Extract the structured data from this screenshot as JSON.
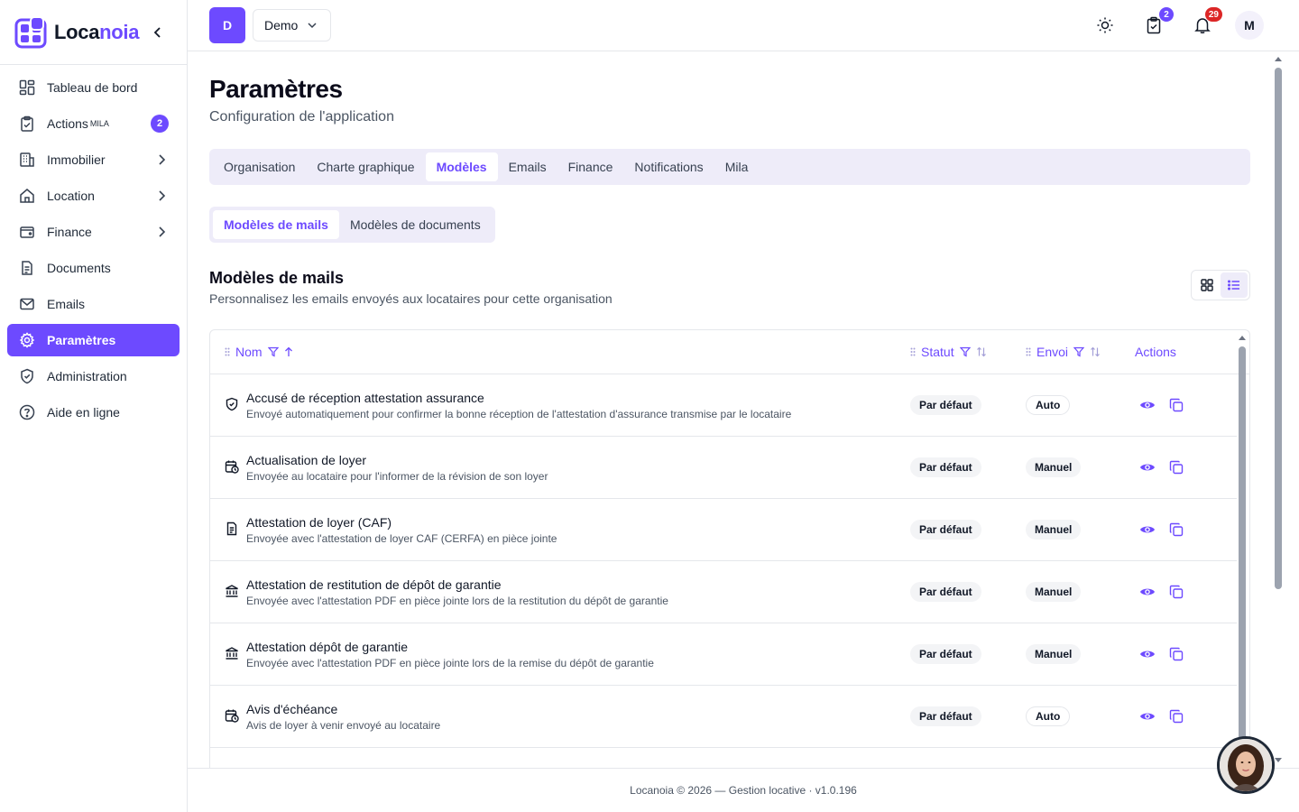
{
  "brand": {
    "name_main": "Loca",
    "name_accent": "noia",
    "accent_color": "#6d4aff"
  },
  "sidebar": {
    "items": [
      {
        "label": "Tableau de bord",
        "icon": "dashboard-icon"
      },
      {
        "label": "Actions",
        "sup": "MILA",
        "badge": "2",
        "icon": "clipboard-check-icon"
      },
      {
        "label": "Immobilier",
        "icon": "building-icon",
        "has_children": true
      },
      {
        "label": "Location",
        "icon": "home-icon",
        "has_children": true
      },
      {
        "label": "Finance",
        "icon": "wallet-icon",
        "has_children": true
      },
      {
        "label": "Documents",
        "icon": "document-icon"
      },
      {
        "label": "Emails",
        "icon": "mail-icon"
      },
      {
        "label": "Paramètres",
        "icon": "gear-icon",
        "active": true
      },
      {
        "label": "Administration",
        "icon": "shield-icon"
      },
      {
        "label": "Aide en ligne",
        "icon": "help-icon"
      }
    ]
  },
  "header": {
    "org_initial": "D",
    "org_name": "Demo",
    "tasks_badge": "2",
    "notifications_badge": "29",
    "user_initial": "M",
    "tasks_badge_color": "#6d4aff",
    "notifications_badge_color": "#dc2626"
  },
  "page": {
    "title": "Paramètres",
    "subtitle": "Configuration de l'application"
  },
  "tabs": [
    {
      "label": "Organisation"
    },
    {
      "label": "Charte graphique"
    },
    {
      "label": "Modèles",
      "active": true
    },
    {
      "label": "Emails"
    },
    {
      "label": "Finance"
    },
    {
      "label": "Notifications"
    },
    {
      "label": "Mila"
    }
  ],
  "subtabs": [
    {
      "label": "Modèles de mails",
      "active": true
    },
    {
      "label": "Modèles de documents"
    }
  ],
  "section": {
    "title": "Modèles de mails",
    "subtitle": "Personnalisez les emails envoyés aux locataires pour cette organisation"
  },
  "table": {
    "columns": {
      "name": "Nom",
      "status": "Statut",
      "send": "Envoi",
      "actions": "Actions"
    },
    "rows": [
      {
        "icon": "shield-check-icon",
        "name": "Accusé de réception attestation assurance",
        "desc": "Envoyé automatiquement pour confirmer la bonne réception de l'attestation d'assurance transmise par le locataire",
        "status": "Par défaut",
        "send": "Auto"
      },
      {
        "icon": "calendar-clock-icon",
        "name": "Actualisation de loyer",
        "desc": "Envoyée au locataire pour l'informer de la révision de son loyer",
        "status": "Par défaut",
        "send": "Manuel"
      },
      {
        "icon": "document-icon",
        "name": "Attestation de loyer (CAF)",
        "desc": "Envoyée avec l'attestation de loyer CAF (CERFA) en pièce jointe",
        "status": "Par défaut",
        "send": "Manuel"
      },
      {
        "icon": "bank-icon",
        "name": "Attestation de restitution de dépôt de garantie",
        "desc": "Envoyée avec l'attestation PDF en pièce jointe lors de la restitution du dépôt de garantie",
        "status": "Par défaut",
        "send": "Manuel"
      },
      {
        "icon": "bank-icon",
        "name": "Attestation dépôt de garantie",
        "desc": "Envoyée avec l'attestation PDF en pièce jointe lors de la remise du dépôt de garantie",
        "status": "Par défaut",
        "send": "Manuel"
      },
      {
        "icon": "calendar-clock-icon",
        "name": "Avis d'échéance",
        "desc": "Avis de loyer à venir envoyé au locataire",
        "status": "Par défaut",
        "send": "Auto"
      }
    ]
  },
  "footer": {
    "text": "Locanoia © 2026 — Gestion locative · v1.0.196"
  }
}
